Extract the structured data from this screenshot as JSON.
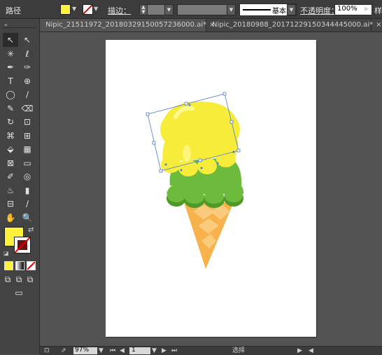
{
  "control_bar": {
    "mode_label": "路径",
    "fill_color": "#fff23d",
    "stroke_label": "描边：",
    "stroke_width_value": "",
    "stroke_profile_label": "基本",
    "opacity_label": "不透明度：",
    "opacity_value": "100%",
    "style_label": "样"
  },
  "tabs": [
    {
      "label": "Nipic_21511972_20180329150057236000.ai*",
      "close": "×"
    },
    {
      "label": "Nipic_20180988_20171229150344445000.ai*",
      "close": "×"
    }
  ],
  "tools": {
    "rows": [
      [
        "selection-tool",
        "direct-selection-tool"
      ],
      [
        "magic-wand-tool",
        "lasso-tool"
      ],
      [
        "pen-tool",
        "curvature-tool"
      ],
      [
        "type-tool",
        "spiral-tool"
      ],
      [
        "ellipse-tool",
        "paintbrush-tool"
      ],
      [
        "pencil-tool",
        "eraser-tool"
      ],
      [
        "rotate-tool",
        "scale-tool"
      ],
      [
        "warp-tool",
        "free-transform-tool"
      ],
      [
        "shape-builder-tool",
        "perspective-grid-tool"
      ],
      [
        "mesh-tool",
        "gradient-tool"
      ],
      [
        "eyedropper-tool",
        "blend-tool"
      ],
      [
        "symbol-sprayer-tool",
        "graph-tool"
      ],
      [
        "artboard-tool",
        "slice-tool"
      ],
      [
        "hand-tool",
        "zoom-tool"
      ]
    ],
    "glyphs": [
      "↖",
      "↖",
      "✳",
      "ℓ",
      "✒",
      "✑",
      "T",
      "⊕",
      "◯",
      "∕",
      "✎",
      "⌫",
      "↻",
      "⊡",
      "⌘",
      "⊞",
      "⬙",
      "▦",
      "⊠",
      "▭",
      "✐",
      "◎",
      "♨",
      "▮",
      "⊟",
      "∕",
      "✋",
      "🔍"
    ],
    "fill_swatch_color": "#fff23d",
    "stroke_swatch_color": "none"
  },
  "status_bar": {
    "zoom_value": "97%",
    "page_value": "1",
    "status_text": "选择"
  },
  "artwork": {
    "scoop_top_color": "#f7ec3a",
    "scoop_top_highlight": "#fdf98a",
    "scoop_mid_color": "#6dbb3c",
    "scoop_mid_dark": "#4d9a2a",
    "cone_color": "#f7b24c",
    "cone_pattern": "#fbd08a"
  }
}
